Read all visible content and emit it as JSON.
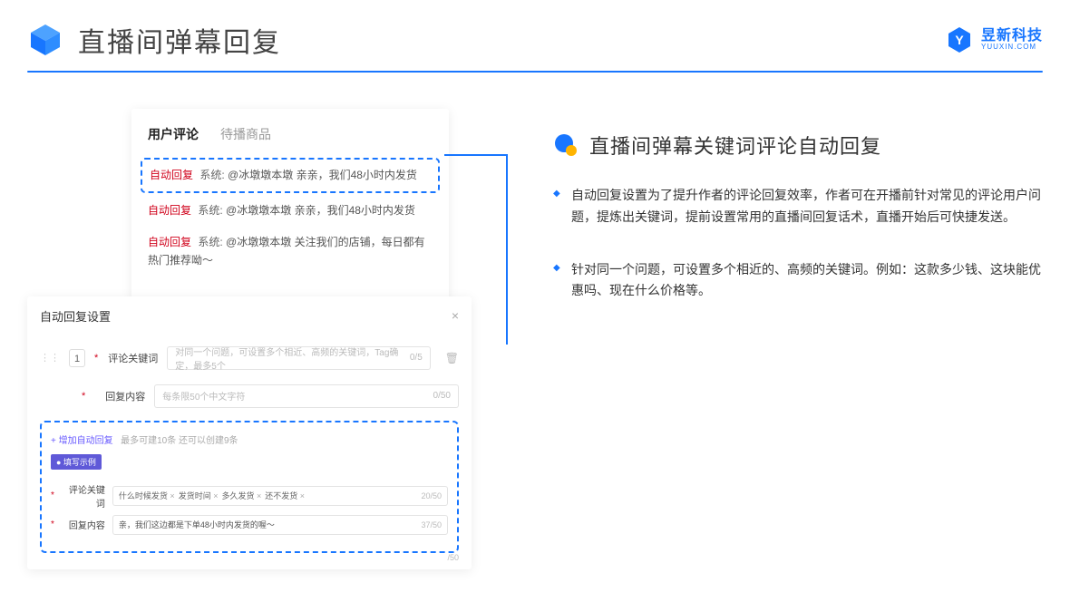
{
  "header": {
    "title": "直播间弹幕回复",
    "brand_name": "昱新科技",
    "brand_sub": "YUUXIN.COM"
  },
  "comments": {
    "tab_active": "用户评论",
    "tab_other": "待播商品",
    "rows": [
      {
        "tag": "自动回复",
        "sys": "系统:",
        "text": "@冰墩墩本墩 亲亲，我们48小时内发货"
      },
      {
        "tag": "自动回复",
        "sys": "系统:",
        "text": "@冰墩墩本墩 亲亲，我们48小时内发货"
      },
      {
        "tag": "自动回复",
        "sys": "系统:",
        "text": "@冰墩墩本墩 关注我们的店铺，每日都有热门推荐呦～"
      }
    ]
  },
  "settings": {
    "title": "自动回复设置",
    "row_num": "1",
    "kw_label": "评论关键词",
    "kw_placeholder": "对同一个问题，可设置多个相近、高频的关键词，Tag确定，最多5个",
    "kw_count": "0/5",
    "content_label": "回复内容",
    "content_placeholder": "每条限50个中文字符",
    "content_count": "0/50",
    "add_link": "+ 增加自动回复",
    "add_note": "最多可建10条 还可以创建9条",
    "example_tag": "● 填写示例",
    "ex_kw_label": "评论关键词",
    "ex_kw_chips": [
      "什么时候发货",
      "发货时间",
      "多久发货",
      "还不发货"
    ],
    "ex_kw_count": "20/50",
    "ex_content_label": "回复内容",
    "ex_content_value": "亲，我们这边都是下单48小时内发货的喔～",
    "ex_content_count": "37/50",
    "extra_count": "/50"
  },
  "right": {
    "title": "直播间弹幕关键词评论自动回复",
    "bullets": [
      "自动回复设置为了提升作者的评论回复效率，作者可在开播前针对常见的评论用户问题，提炼出关键词，提前设置常用的直播间回复话术，直播开始后可快捷发送。",
      "针对同一个问题，可设置多个相近的、高频的关键词。例如：这款多少钱、这块能优惠吗、现在什么价格等。"
    ]
  }
}
